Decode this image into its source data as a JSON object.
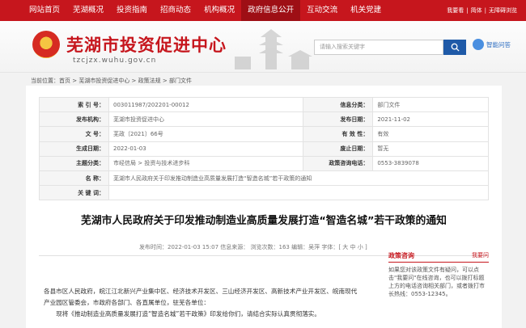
{
  "nav": {
    "items": [
      "网站首页",
      "芜湖概况",
      "投资指南",
      "招商动态",
      "机构概况",
      "政府信息公开",
      "互动交流",
      "机关党建"
    ],
    "active_index": 5,
    "right_links": [
      "我要看",
      "简体",
      "无障碍浏览"
    ]
  },
  "header": {
    "title": "芜湖市投资促进中心",
    "url": "tzcjzx.wuhu.gov.cn",
    "search_placeholder": "请输入搜索关键字",
    "smart_ask": "智能问答"
  },
  "breadcrumb": [
    "当前位置：首页",
    "芜湖市投资促进中心",
    "政策法规",
    "部门文件"
  ],
  "meta": {
    "index_label": "索 引 号：",
    "index_value": "003011987/202201-00012",
    "info_class_label": "信息分类：",
    "info_class_value": "部门文件",
    "publisher_label": "发布机构：",
    "publisher_value": "芜湖市投资促进中心",
    "pub_date_label": "发布日期：",
    "pub_date_value": "2021-11-02",
    "doc_no_label": "文   号：",
    "doc_no_value": "芜政〔2021〕66号",
    "validity_label": "有 效 性：",
    "validity_value": "有效",
    "gen_date_label": "生成日期：",
    "gen_date_value": "2022-01-03",
    "abolish_date_label": "废止日期：",
    "abolish_date_value": "暂无",
    "category_label": "主题分类：",
    "category_value": "市经信局 > 投资与技术进步科",
    "phone_label": "政策咨询电话：",
    "phone_value": "0553-3839078",
    "name_label": "名   称：",
    "name_value": "芜湖市人民政府关于印发推动制造业高质量发展打造“智造名城”若干政策的通知",
    "keyword_label": "关 键 词：",
    "keyword_value": ""
  },
  "document": {
    "title": "芜湖市人民政府关于印发推动制造业高质量发展打造“智造名城”若干政策的通知",
    "info": "发布时间：2022-01-03 15:07   信息来源：   浏览次数：163   编辑：吴萍   字体：[ 大  中  小 ]",
    "paragraphs": [
      "各县市区人民政府，皖江江北新兴产业集中区、经济技术开发区、三山经济开发区、高新技术产业开发区、皖南现代产业园区管委会，市政府各部门、各直属单位，驻芜各单位：",
      "现将《推动制造业高质量发展打造“智造名城”若干政策》印发给你们，请结合实际认真贯彻落实。"
    ]
  },
  "consult": {
    "title": "政策咨询",
    "ask": "我要问",
    "desc": "如果您对该政策文件有疑问，可以点击\"我要问\"在线咨询，也可以拨打标题上方的电话咨询相关部门，或者拨打市长热线：0553-12345。"
  },
  "colors": {
    "brand": "#c6161d",
    "accent": "#1f5aa8"
  }
}
